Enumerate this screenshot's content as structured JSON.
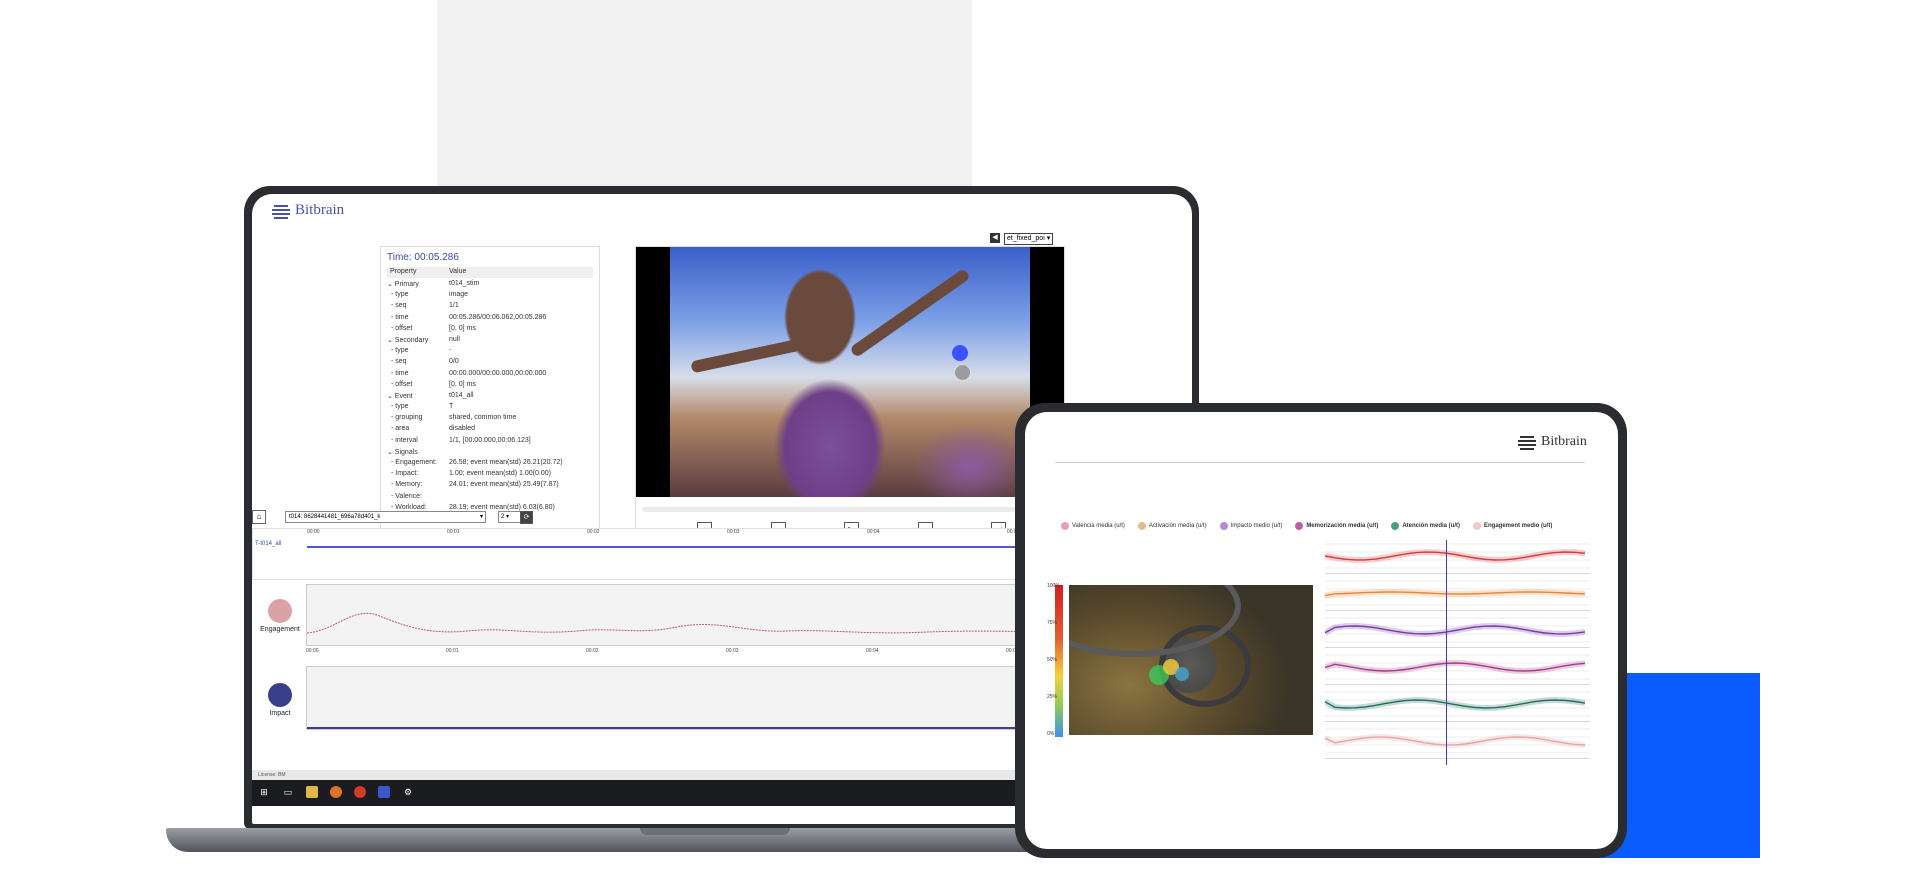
{
  "laptop": {
    "brand": "Bitbrain",
    "properties": {
      "time": "Time: 00:05.286",
      "col_property": "Property",
      "col_value": "Value",
      "rows": [
        {
          "k": "Primary",
          "v": "t014_stim",
          "grp": true
        },
        {
          "k": "- type",
          "v": "image"
        },
        {
          "k": "- seq",
          "v": "1/1"
        },
        {
          "k": "- time",
          "v": "00:05.286/00:06.062,00:05.286"
        },
        {
          "k": "- offset",
          "v": "[0, 0] ms"
        },
        {
          "k": "Secondary",
          "v": "null",
          "grp": true
        },
        {
          "k": "- type",
          "v": "-"
        },
        {
          "k": "- seq",
          "v": "0/0"
        },
        {
          "k": "- time",
          "v": "00:00.000/00:00.000,00:00.000"
        },
        {
          "k": "- offset",
          "v": "[0, 0] ms"
        },
        {
          "k": "Event",
          "v": "t014_all",
          "grp": true
        },
        {
          "k": "- type",
          "v": "T"
        },
        {
          "k": "- grouping",
          "v": "shared, common time"
        },
        {
          "k": "- area",
          "v": "disabled"
        },
        {
          "k": "- interval",
          "v": "1/1, [00:00.000,00:06.123]"
        },
        {
          "k": "Signals",
          "v": "",
          "grp": true
        },
        {
          "k": "- Engagement:",
          "v": "26.58; event mean(std) 26.21(20.72)"
        },
        {
          "k": "- Impact:",
          "v": "1.00; event mean(std) 1.00(0.00)"
        },
        {
          "k": "- Memory:",
          "v": "24.01; event mean(std) 25.49(7.87)"
        },
        {
          "k": "- Valence:",
          "v": ""
        },
        {
          "k": "- Workload:",
          "v": "28.19; event mean(std) 6.03(6.80)"
        }
      ]
    },
    "video_select": "et_fixed_poi",
    "timeline": {
      "stimulus": "t014: 8628441481_696a78d401_k",
      "num": "2",
      "track_label": "T-t014_all",
      "ticks": [
        "00:00",
        "00:01",
        "00:02",
        "00:03",
        "00:04",
        "00:05"
      ],
      "signals": [
        {
          "name": "Engagement",
          "color": "#d9a3a6"
        },
        {
          "name": "Impact",
          "color": "#3b3f8a"
        }
      ],
      "license": "License: BM"
    }
  },
  "tablet": {
    "brand": "Bitbrain",
    "legend": [
      {
        "label": "Valencia media (u/t)",
        "color": "#e7a1ad",
        "bold": false
      },
      {
        "label": "Activación media (u/t)",
        "color": "#e6b98a",
        "bold": false
      },
      {
        "label": "Impacto medio (u/t)",
        "color": "#b78ad3",
        "bold": false
      },
      {
        "label": "Memorización media (u/t)",
        "color": "#b763a8",
        "bold": true
      },
      {
        "label": "Atención media (u/t)",
        "color": "#4c9c88",
        "bold": true
      },
      {
        "label": "Engagement medio (u/t)",
        "color": "#f2c8c8",
        "bold": true
      }
    ],
    "heat_scale": [
      "100%",
      "75%",
      "50%",
      "25%",
      "0%"
    ],
    "series_colors": [
      "#d63a3a",
      "#e38a3a",
      "#7a3aa8",
      "#a83a8a",
      "#1f6e5e",
      "#e2a6a6"
    ]
  }
}
